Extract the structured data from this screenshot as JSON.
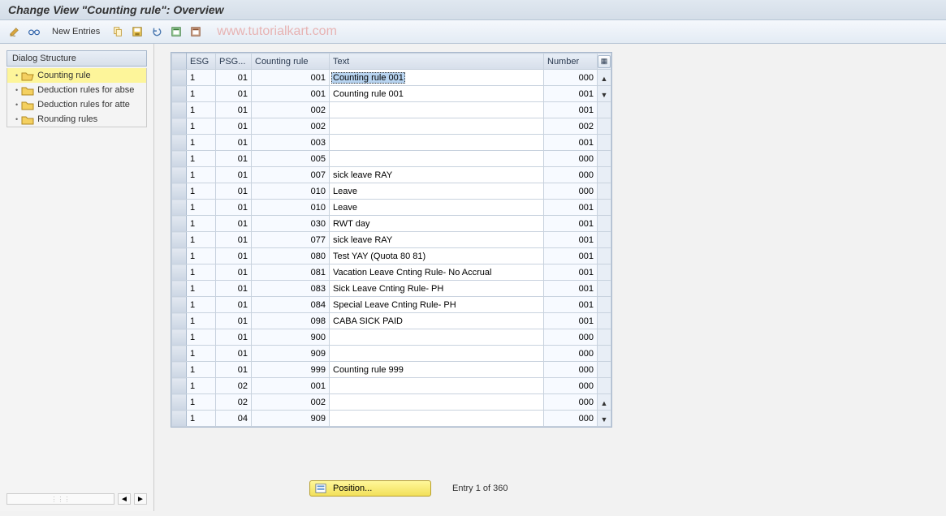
{
  "title": "Change View \"Counting rule\": Overview",
  "toolbar": {
    "new_entries": "New Entries"
  },
  "watermark": "www.tutorialkart.com",
  "sidebar": {
    "header": "Dialog Structure",
    "items": [
      {
        "label": "Counting rule",
        "open": true,
        "selected": true
      },
      {
        "label": "Deduction rules for abse",
        "open": false,
        "selected": false
      },
      {
        "label": "Deduction rules for atte",
        "open": false,
        "selected": false
      },
      {
        "label": "Rounding rules",
        "open": false,
        "selected": false
      }
    ]
  },
  "grid": {
    "columns": {
      "esg": "ESG",
      "psg": "PSG...",
      "rule": "Counting rule",
      "text": "Text",
      "number": "Number"
    },
    "rows": [
      {
        "esg": "1",
        "psg": "01",
        "rule": "001",
        "text": "Counting rule 001",
        "number": "000",
        "selected": true
      },
      {
        "esg": "1",
        "psg": "01",
        "rule": "001",
        "text": "Counting rule 001",
        "number": "001"
      },
      {
        "esg": "1",
        "psg": "01",
        "rule": "002",
        "text": "",
        "number": "001"
      },
      {
        "esg": "1",
        "psg": "01",
        "rule": "002",
        "text": "",
        "number": "002"
      },
      {
        "esg": "1",
        "psg": "01",
        "rule": "003",
        "text": "",
        "number": "001"
      },
      {
        "esg": "1",
        "psg": "01",
        "rule": "005",
        "text": "",
        "number": "000"
      },
      {
        "esg": "1",
        "psg": "01",
        "rule": "007",
        "text": "sick leave RAY",
        "number": "000"
      },
      {
        "esg": "1",
        "psg": "01",
        "rule": "010",
        "text": "Leave",
        "number": "000"
      },
      {
        "esg": "1",
        "psg": "01",
        "rule": "010",
        "text": "Leave",
        "number": "001"
      },
      {
        "esg": "1",
        "psg": "01",
        "rule": "030",
        "text": "RWT day",
        "number": "001"
      },
      {
        "esg": "1",
        "psg": "01",
        "rule": "077",
        "text": "sick leave RAY",
        "number": "001"
      },
      {
        "esg": "1",
        "psg": "01",
        "rule": "080",
        "text": "Test YAY (Quota 80 81)",
        "number": "001"
      },
      {
        "esg": "1",
        "psg": "01",
        "rule": "081",
        "text": "Vacation Leave Cnting Rule- No Accrual",
        "number": "001"
      },
      {
        "esg": "1",
        "psg": "01",
        "rule": "083",
        "text": "Sick Leave Cnting Rule- PH",
        "number": "001"
      },
      {
        "esg": "1",
        "psg": "01",
        "rule": "084",
        "text": "Special Leave Cnting Rule- PH",
        "number": "001"
      },
      {
        "esg": "1",
        "psg": "01",
        "rule": "098",
        "text": "CABA SICK PAID",
        "number": "001"
      },
      {
        "esg": "1",
        "psg": "01",
        "rule": "900",
        "text": "",
        "number": "000"
      },
      {
        "esg": "1",
        "psg": "01",
        "rule": "909",
        "text": "",
        "number": "000"
      },
      {
        "esg": "1",
        "psg": "01",
        "rule": "999",
        "text": "Counting rule 999",
        "number": "000"
      },
      {
        "esg": "1",
        "psg": "02",
        "rule": "001",
        "text": "",
        "number": "000"
      },
      {
        "esg": "1",
        "psg": "02",
        "rule": "002",
        "text": "",
        "number": "000"
      },
      {
        "esg": "1",
        "psg": "04",
        "rule": "909",
        "text": "",
        "number": "000"
      }
    ]
  },
  "footer": {
    "position_label": "Position...",
    "entry_info": "Entry 1 of 360"
  }
}
